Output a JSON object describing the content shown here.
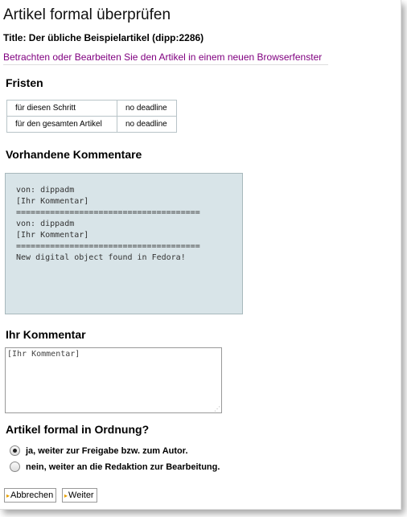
{
  "page": {
    "title": "Artikel formal überprüfen",
    "subtitle": "Title: Der übliche Beispielartikel (dipp:2286)",
    "link_text": "Betrachten oder Bearbeiten Sie den Artikel in einem neuen Browserfenster"
  },
  "deadlines": {
    "heading": "Fristen",
    "rows": [
      {
        "label": "für diesen Schritt",
        "value": "no deadline"
      },
      {
        "label": "für den gesamten Artikel",
        "value": "no deadline"
      }
    ]
  },
  "comments": {
    "heading": "Vorhandene Kommentare",
    "text": "von: dippadm\n[Ihr Kommentar]\n======================================\nvon: dippadm\n[Ihr Kommentar]\n======================================\nNew digital object found in Fedora!"
  },
  "my_comment": {
    "heading": "Ihr Kommentar",
    "value": "[Ihr Kommentar]"
  },
  "decision": {
    "heading": "Artikel formal in Ordnung?",
    "options": [
      {
        "label": "ja, weiter zur Freigabe bzw. zum Autor.",
        "checked": true
      },
      {
        "label": "nein, weiter an die Redaktion zur Bearbeitung.",
        "checked": false
      }
    ]
  },
  "buttons": {
    "cancel": "Abbrechen",
    "next": "Weiter"
  }
}
